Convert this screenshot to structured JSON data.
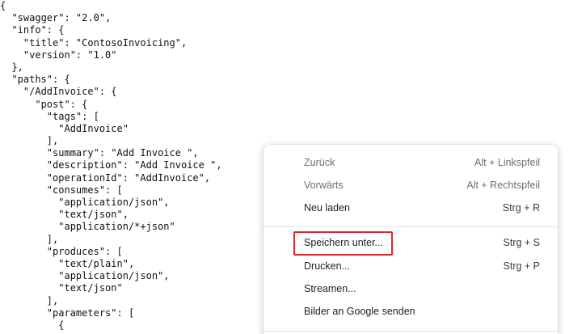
{
  "json_view": {
    "lines": [
      "{",
      "  \"swagger\": \"2.0\",",
      "  \"info\": {",
      "    \"title\": \"ContosoInvoicing\",",
      "    \"version\": \"1.0\"",
      "  },",
      "  \"paths\": {",
      "    \"/AddInvoice\": {",
      "      \"post\": {",
      "        \"tags\": [",
      "          \"AddInvoice\"",
      "        ],",
      "        \"summary\": \"Add Invoice \",",
      "        \"description\": \"Add Invoice \",",
      "        \"operationId\": \"AddInvoice\",",
      "        \"consumes\": [",
      "          \"application/json\",",
      "          \"text/json\",",
      "          \"application/*+json\"",
      "        ],",
      "        \"produces\": [",
      "          \"text/plain\",",
      "          \"application/json\",",
      "          \"text/json\"",
      "        ],",
      "        \"parameters\": [",
      "          {"
    ]
  },
  "context_menu": {
    "items": [
      {
        "label": "Zurück",
        "shortcut": "Alt + Linkspfeil",
        "disabled": true
      },
      {
        "label": "Vorwärts",
        "shortcut": "Alt + Rechtspfeil",
        "disabled": true
      },
      {
        "label": "Neu laden",
        "shortcut": "Strg + R",
        "disabled": false
      },
      {
        "label": "Speichern unter...",
        "shortcut": "Strg + S",
        "disabled": false,
        "highlighted": true
      },
      {
        "label": "Drucken...",
        "shortcut": "Strg + P",
        "disabled": false
      },
      {
        "label": "Streamen...",
        "shortcut": "",
        "disabled": false
      },
      {
        "label": "Bilder an Google senden",
        "shortcut": "",
        "disabled": false
      }
    ]
  },
  "colors": {
    "highlight_border": "#d9262c",
    "disabled_text": "#6e6e6e"
  }
}
